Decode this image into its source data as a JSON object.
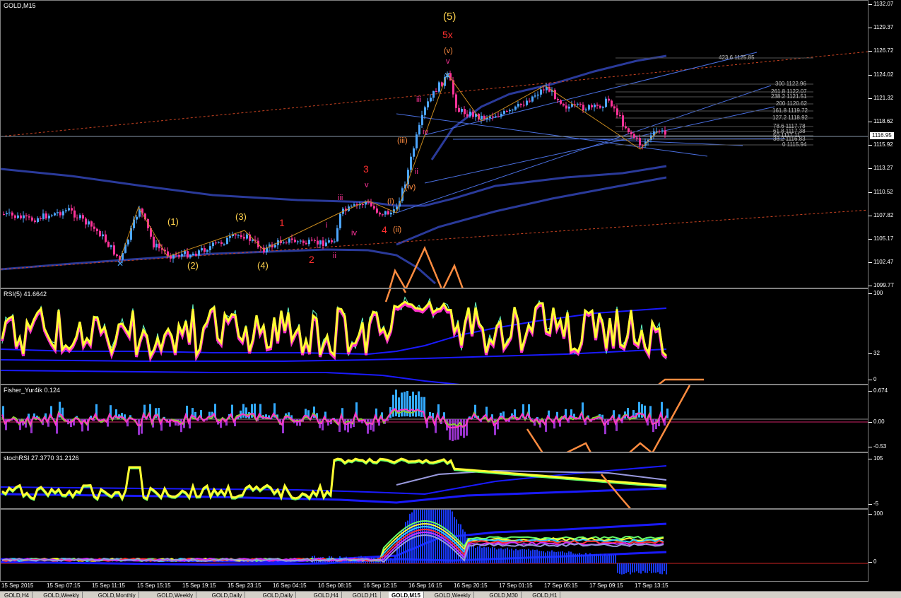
{
  "main": {
    "label": "GOLD,M15",
    "price_ticks": [
      "1132.07",
      "1129.37",
      "1126.72",
      "1124.02",
      "1121.32",
      "1118.62",
      "1115.92",
      "1113.27",
      "1110.52",
      "1107.82",
      "1105.17",
      "1102.47",
      "1099.77"
    ],
    "current_price": "1116.95",
    "levels": [
      "423.6 1125.85",
      "300 1122.96",
      "261.8 1122.07",
      "238.2 1121.51",
      "200 1120.62",
      "161.8 1119.72",
      "127.2 1118.92",
      "78.6 1117.78",
      "61.8 1117.38",
      "50 1117.11",
      "38.2 1116.83",
      "0 1115.94"
    ],
    "wave_labels": {
      "w5": "(5)",
      "w5x": "5x",
      "wv": "(v)",
      "v1": "v",
      "v2": "v",
      "w1": "(1)",
      "w2": "(2)",
      "w3": "(3)",
      "w4": "(4)",
      "r1": "1",
      "r2": "2",
      "r3": "3",
      "r4": "4",
      "i1": "i",
      "ii1": "ii",
      "iii1": "iii",
      "iv1": "iv",
      "oi": "(i)",
      "oii": "(ii)",
      "oiii": "(iii)",
      "oiv": "(iv)",
      "iii2": "iii",
      "iv2": "iv",
      "ii2": "ii"
    }
  },
  "rsi": {
    "label": "RSI(5) 41.6642",
    "ticks": [
      "100",
      "32",
      "0"
    ]
  },
  "fisher": {
    "label": "Fisher_Yur4ik 0.124",
    "ticks": [
      "0.674",
      "0.00",
      "-0.53"
    ]
  },
  "stoch": {
    "label": "stochRSI 27.3770 31.2126",
    "ticks": [
      "105",
      "-5"
    ]
  },
  "fifth": {
    "ticks": [
      "100",
      "0"
    ]
  },
  "time_ticks": [
    "15 Sep 2015",
    "15 Sep 07:15",
    "15 Sep 11:15",
    "15 Sep 15:15",
    "15 Sep 19:15",
    "15 Sep 23:15",
    "16 Sep 04:15",
    "16 Sep 08:15",
    "16 Sep 12:15",
    "16 Sep 16:15",
    "16 Sep 20:15",
    "17 Sep 01:15",
    "17 Sep 05:15",
    "17 Sep 09:15",
    "17 Sep 13:15"
  ],
  "tabs": [
    "GOLD,H4",
    "GOLD,Weekly",
    "GOLD,Monthly",
    "GOLD,Weekly",
    "GOLD,Daily",
    "GOLD,Daily",
    "GOLD,H4",
    "GOLD,H1",
    "GOLD,M15",
    "GOLD,Weekly",
    "GOLD,M30",
    "GOLD,H1"
  ],
  "active_tab_index": 8,
  "colors": {
    "bull": "#4da6ff",
    "bear": "#ff3399",
    "rsi": "#ffff33",
    "orange": "#ff8c40",
    "channel": "#2a3a9a"
  }
}
